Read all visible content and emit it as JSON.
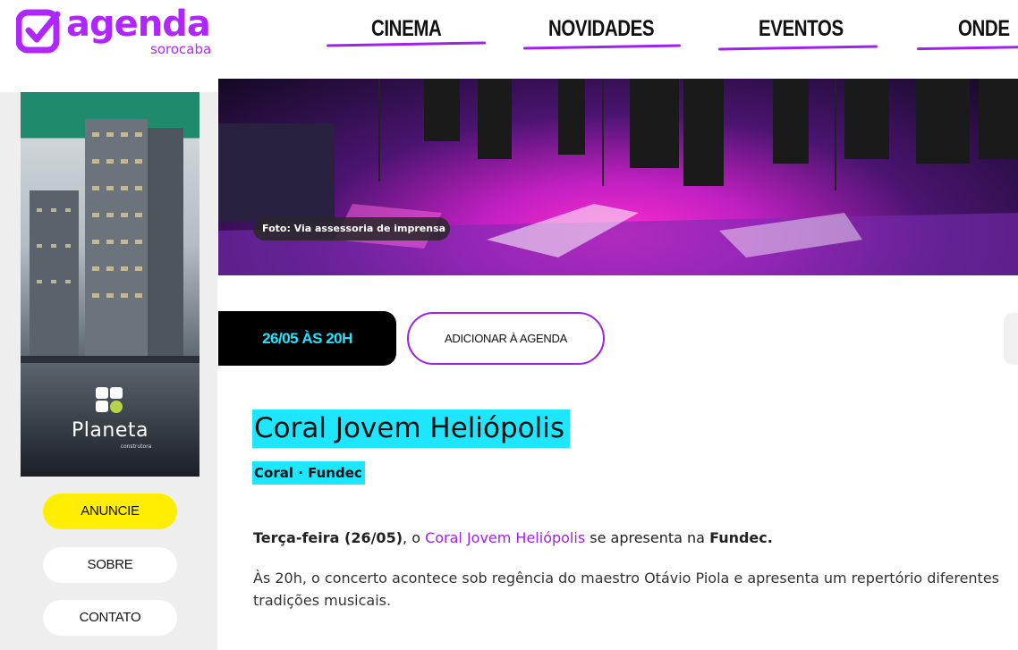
{
  "header": {
    "logo": {
      "main": "agenda",
      "sub": "sorocaba"
    },
    "nav": [
      {
        "label": "CINEMA"
      },
      {
        "label": "NOVIDADES"
      },
      {
        "label": "EVENTOS"
      },
      {
        "label": "ONDE"
      }
    ],
    "accent_color": "#a020f0"
  },
  "sidebar": {
    "ad": {
      "brand": "Planeta",
      "tagline": "construtora"
    },
    "buttons": [
      {
        "label": "ANUNCIE",
        "color": "#ffee00"
      },
      {
        "label": "SOBRE"
      },
      {
        "label": "CONTATO"
      }
    ]
  },
  "hero": {
    "caption": "Foto: Via assessoria de imprensa"
  },
  "event": {
    "date": "26/05 ÀS 20H",
    "add_button": "ADICIONAR À AGENDA",
    "title": "Coral Jovem Heliópolis",
    "subtitle": "Coral · Fundec",
    "highlight_color": "#1ee6ff",
    "para1": {
      "t1": "Terça-feira (26/05)",
      "t2": ", o ",
      "t3": "Coral Jovem Heliópolis",
      "t4": " se apresenta na ",
      "t5": "Fundec."
    },
    "para2": "Às 20h, o concerto acontece sob regência do maestro Otávio Piola e apresenta um repertório diferentes tradições musicais."
  }
}
